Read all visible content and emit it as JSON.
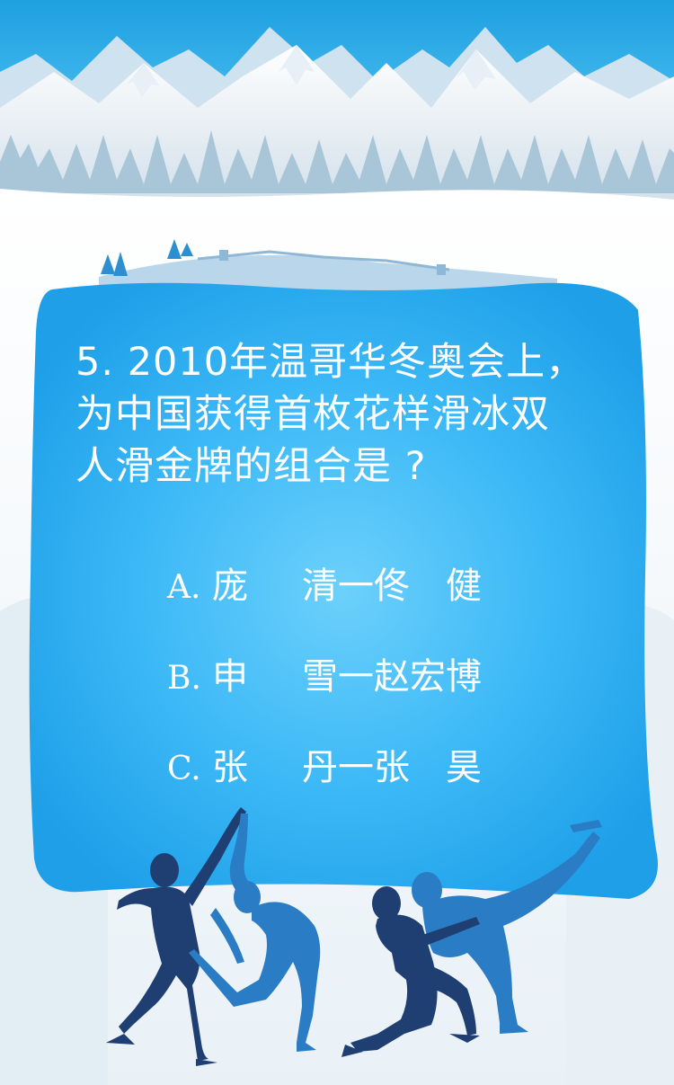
{
  "quiz": {
    "question_lines": [
      "5. 2010年温哥华冬奥会上，",
      "为中国获得首枚花样滑冰双",
      "人滑金牌的组合是 ?"
    ],
    "options": [
      {
        "letter": "A.",
        "first": "庞",
        "rest": "清一佟　健"
      },
      {
        "letter": "B.",
        "first": "申",
        "rest": "雪一赵宏博"
      },
      {
        "letter": "C.",
        "first": "张",
        "rest": "丹一张　昊"
      }
    ]
  },
  "colors": {
    "sky_top": "#2aa8e6",
    "card_blue": "#2fb3f5",
    "card_center": "#5cc8fa",
    "skater_dark": "#1f3f73",
    "skater_light": "#2a7dc4",
    "snow": "#eef5fa"
  },
  "decor": {
    "scene": "snowy mountains with pine trees and a great wall on a hill",
    "figures": [
      "figure-skating-pair-lift-icon",
      "figure-skating-pair-kneel-icon"
    ]
  }
}
